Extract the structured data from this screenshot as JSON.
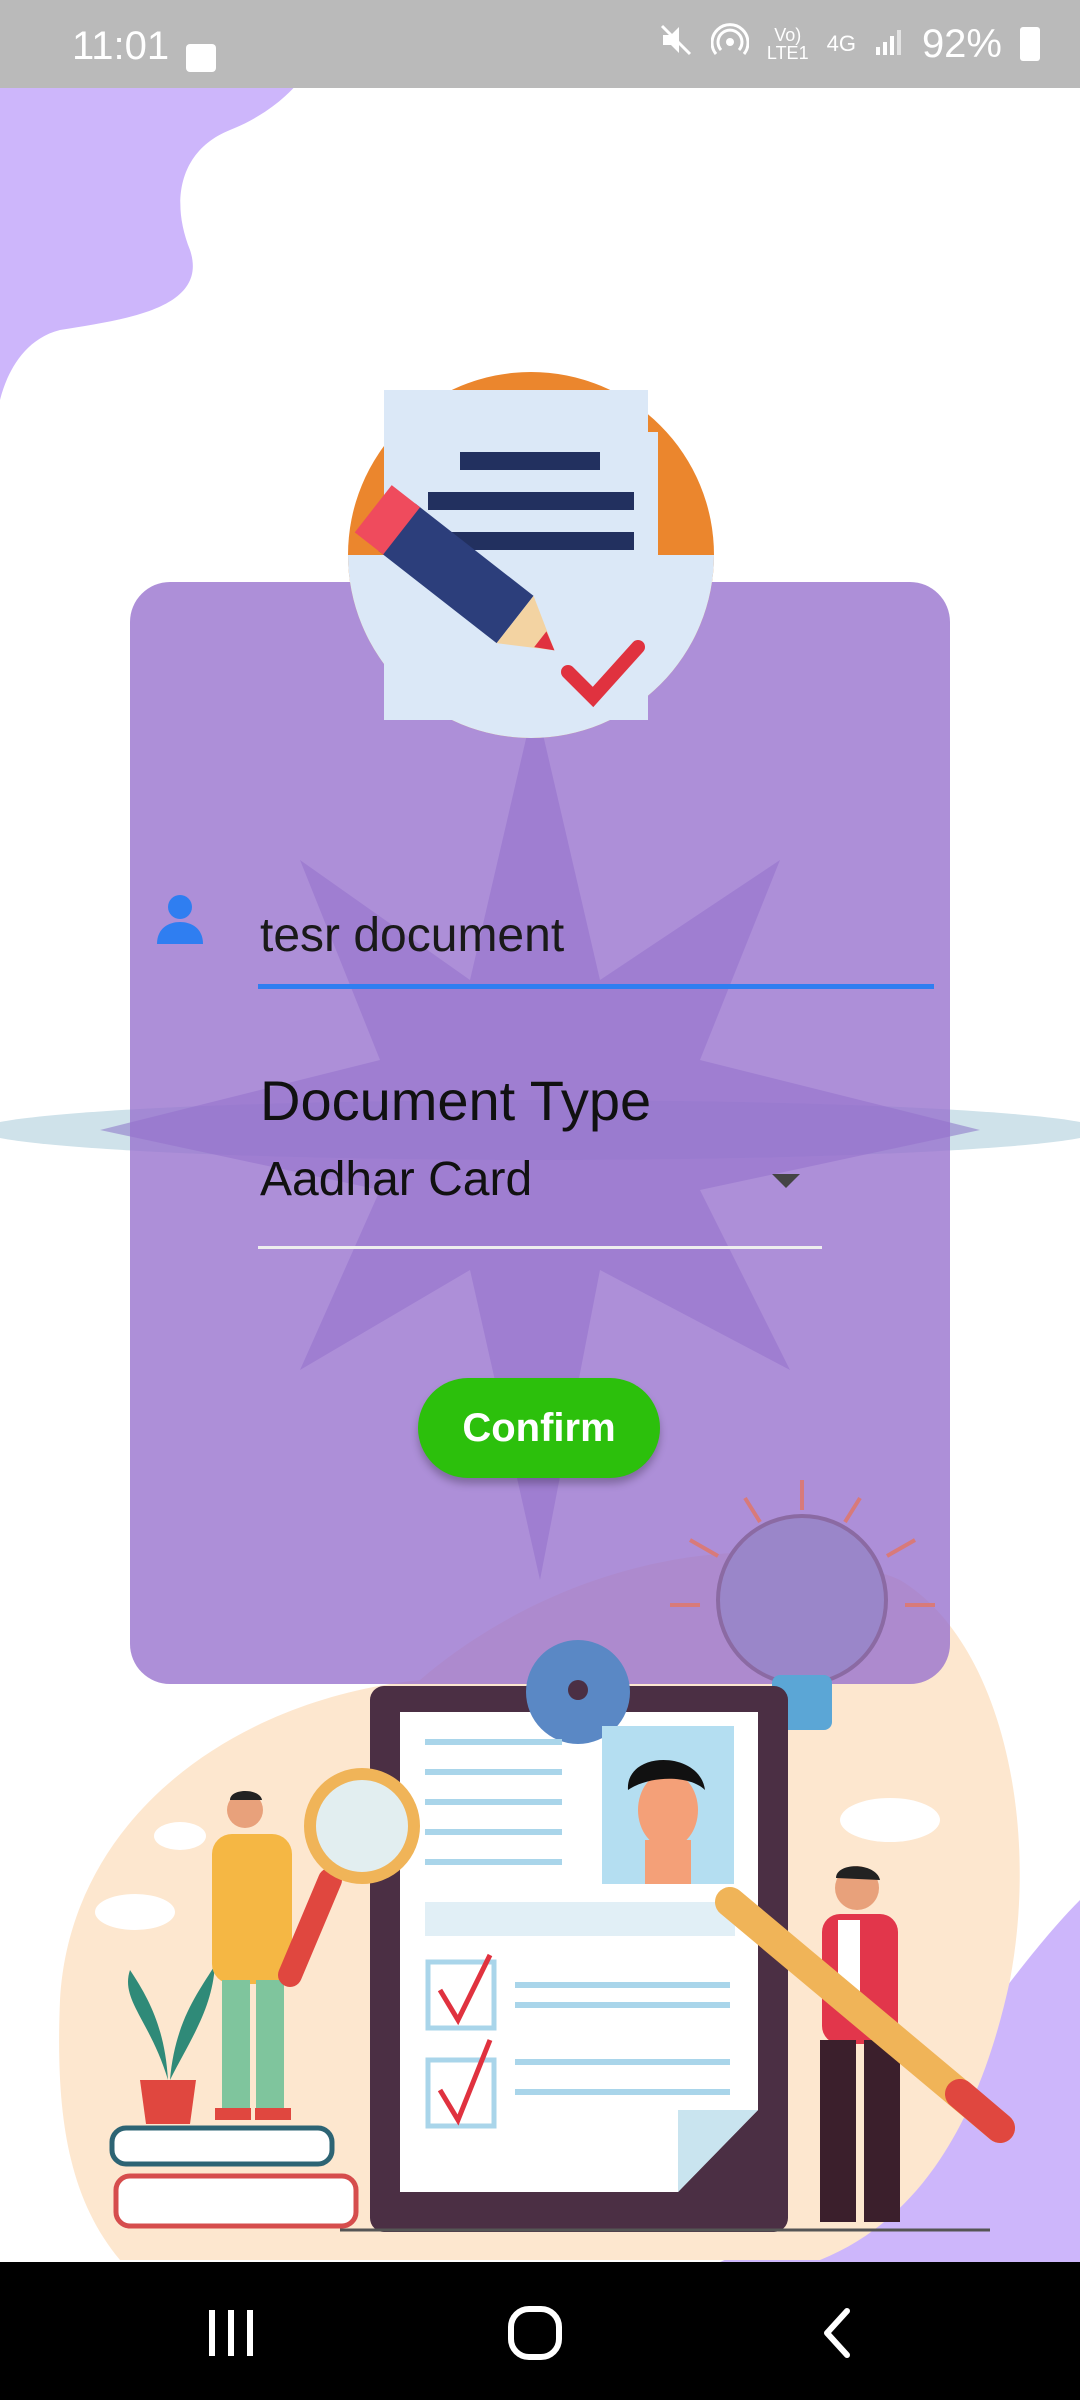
{
  "status_bar": {
    "time": "11:01",
    "battery": "92%",
    "network_label_top": "Vo)",
    "network_label_bottom": "LTE1",
    "network_type": "4G",
    "icons": [
      "gallery-icon",
      "mute-icon",
      "hotspot-icon",
      "signal-icon",
      "battery-icon"
    ]
  },
  "form": {
    "name_value": "tesr document",
    "name_icon": "person-icon",
    "document_type_label": "Document Type",
    "document_type_value": "Aadhar Card",
    "confirm_label": "Confirm"
  },
  "nav_bar": {
    "items": [
      "recent-apps-icon",
      "home-icon",
      "back-icon"
    ]
  },
  "colors": {
    "card": "#9670cd",
    "accent_blue": "#2f7ef1",
    "confirm": "#2cc00c",
    "status_bar": "#bababa",
    "blob": "#cdb6fb"
  }
}
